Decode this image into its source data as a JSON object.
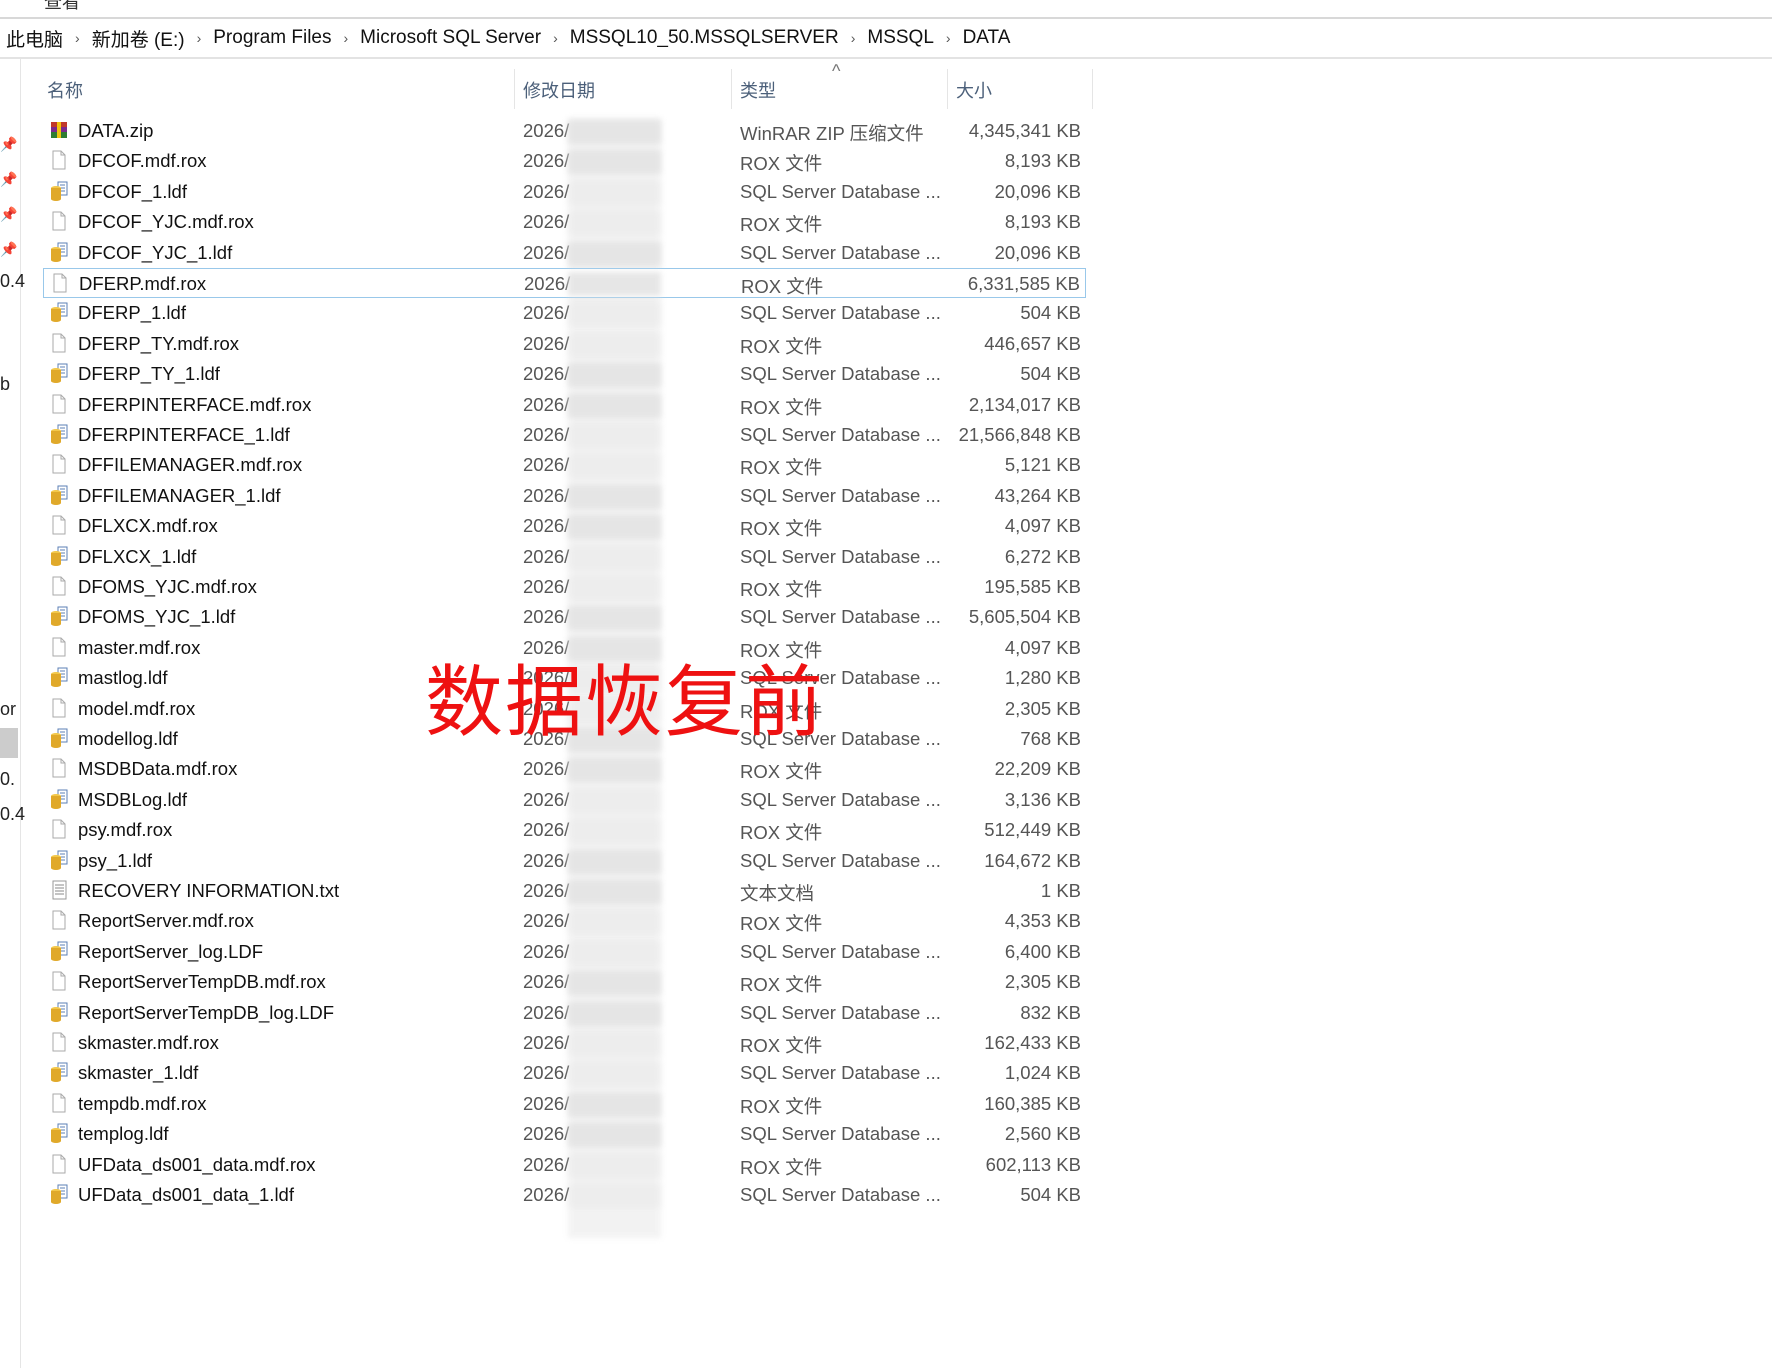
{
  "menu": {
    "view": "查看"
  },
  "breadcrumb": [
    "此电脑",
    "新加卷 (E:)",
    "Program Files",
    "Microsoft SQL Server",
    "MSSQL10_50.MSSQLSERVER",
    "MSSQL",
    "DATA"
  ],
  "columns": {
    "name": "名称",
    "date": "修改日期",
    "type": "类型",
    "size": "大小",
    "sort_indicator": "^"
  },
  "left_pane_fragments": [
    "0.4",
    "b",
    "or",
    "0.",
    "0.4"
  ],
  "files": [
    {
      "name": "DATA.zip",
      "date": "2026/",
      "type": "WinRAR ZIP 压缩文件",
      "size": "4,345,341 KB",
      "icon": "zip"
    },
    {
      "name": "DFCOF.mdf.rox",
      "date": "2026/",
      "type": "ROX 文件",
      "size": "8,193 KB",
      "icon": "file"
    },
    {
      "name": "DFCOF_1.ldf",
      "date": "2026/",
      "type": "SQL Server Database ...",
      "size": "20,096 KB",
      "icon": "db"
    },
    {
      "name": "DFCOF_YJC.mdf.rox",
      "date": "2026/",
      "type": "ROX 文件",
      "size": "8,193 KB",
      "icon": "file"
    },
    {
      "name": "DFCOF_YJC_1.ldf",
      "date": "2026/",
      "type": "SQL Server Database ...",
      "size": "20,096 KB",
      "icon": "db"
    },
    {
      "name": "DFERP.mdf.rox",
      "date": "2026/",
      "type": "ROX 文件",
      "size": "6,331,585 KB",
      "icon": "file",
      "selected": true
    },
    {
      "name": "DFERP_1.ldf",
      "date": "2026/",
      "type": "SQL Server Database ...",
      "size": "504 KB",
      "icon": "db"
    },
    {
      "name": "DFERP_TY.mdf.rox",
      "date": "2026/",
      "type": "ROX 文件",
      "size": "446,657 KB",
      "icon": "file"
    },
    {
      "name": "DFERP_TY_1.ldf",
      "date": "2026/",
      "type": "SQL Server Database ...",
      "size": "504 KB",
      "icon": "db"
    },
    {
      "name": "DFERPINTERFACE.mdf.rox",
      "date": "2026/",
      "type": "ROX 文件",
      "size": "2,134,017 KB",
      "icon": "file"
    },
    {
      "name": "DFERPINTERFACE_1.ldf",
      "date": "2026/",
      "type": "SQL Server Database ...",
      "size": "21,566,848 KB",
      "icon": "db"
    },
    {
      "name": "DFFILEMANAGER.mdf.rox",
      "date": "2026/",
      "type": "ROX 文件",
      "size": "5,121 KB",
      "icon": "file"
    },
    {
      "name": "DFFILEMANAGER_1.ldf",
      "date": "2026/",
      "type": "SQL Server Database ...",
      "size": "43,264 KB",
      "icon": "db"
    },
    {
      "name": "DFLXCX.mdf.rox",
      "date": "2026/",
      "type": "ROX 文件",
      "size": "4,097 KB",
      "icon": "file"
    },
    {
      "name": "DFLXCX_1.ldf",
      "date": "2026/",
      "type": "SQL Server Database ...",
      "size": "6,272 KB",
      "icon": "db"
    },
    {
      "name": "DFOMS_YJC.mdf.rox",
      "date": "2026/",
      "type": "ROX 文件",
      "size": "195,585 KB",
      "icon": "file"
    },
    {
      "name": "DFOMS_YJC_1.ldf",
      "date": "2026/",
      "type": "SQL Server Database ...",
      "size": "5,605,504 KB",
      "icon": "db"
    },
    {
      "name": "master.mdf.rox",
      "date": "2026/",
      "type": "ROX 文件",
      "size": "4,097 KB",
      "icon": "file"
    },
    {
      "name": "mastlog.ldf",
      "date": "2026/",
      "type": "SQL Server Database ...",
      "size": "1,280 KB",
      "icon": "db"
    },
    {
      "name": "model.mdf.rox",
      "date": "2026/",
      "type": "ROX 文件",
      "size": "2,305 KB",
      "icon": "file"
    },
    {
      "name": "modellog.ldf",
      "date": "2026/",
      "type": "SQL Server Database ...",
      "size": "768 KB",
      "icon": "db"
    },
    {
      "name": "MSDBData.mdf.rox",
      "date": "2026/",
      "type": "ROX 文件",
      "size": "22,209 KB",
      "icon": "file"
    },
    {
      "name": "MSDBLog.ldf",
      "date": "2026/",
      "type": "SQL Server Database ...",
      "size": "3,136 KB",
      "icon": "db"
    },
    {
      "name": "psy.mdf.rox",
      "date": "2026/",
      "type": "ROX 文件",
      "size": "512,449 KB",
      "icon": "file"
    },
    {
      "name": "psy_1.ldf",
      "date": "2026/",
      "type": "SQL Server Database ...",
      "size": "164,672 KB",
      "icon": "db"
    },
    {
      "name": "RECOVERY INFORMATION.txt",
      "date": "2026/",
      "type": "文本文档",
      "size": "1 KB",
      "icon": "txt"
    },
    {
      "name": "ReportServer.mdf.rox",
      "date": "2026/",
      "type": "ROX 文件",
      "size": "4,353 KB",
      "icon": "file"
    },
    {
      "name": "ReportServer_log.LDF",
      "date": "2026/",
      "type": "SQL Server Database ...",
      "size": "6,400 KB",
      "icon": "db"
    },
    {
      "name": "ReportServerTempDB.mdf.rox",
      "date": "2026/",
      "type": "ROX 文件",
      "size": "2,305 KB",
      "icon": "file"
    },
    {
      "name": "ReportServerTempDB_log.LDF",
      "date": "2026/",
      "type": "SQL Server Database ...",
      "size": "832 KB",
      "icon": "db"
    },
    {
      "name": "skmaster.mdf.rox",
      "date": "2026/",
      "type": "ROX 文件",
      "size": "162,433 KB",
      "icon": "file"
    },
    {
      "name": "skmaster_1.ldf",
      "date": "2026/",
      "type": "SQL Server Database ...",
      "size": "1,024 KB",
      "icon": "db"
    },
    {
      "name": "tempdb.mdf.rox",
      "date": "2026/",
      "type": "ROX 文件",
      "size": "160,385 KB",
      "icon": "file"
    },
    {
      "name": "templog.ldf",
      "date": "2026/",
      "type": "SQL Server Database ...",
      "size": "2,560 KB",
      "icon": "db"
    },
    {
      "name": "UFData_ds001_data.mdf.rox",
      "date": "2026/",
      "type": "ROX 文件",
      "size": "602,113 KB",
      "icon": "file"
    },
    {
      "name": "UFData_ds001_data_1.ldf",
      "date": "2026/",
      "type": "SQL Server Database ...",
      "size": "504 KB",
      "icon": "db"
    }
  ],
  "watermark": "数据恢复前",
  "colors": {
    "watermark": "#ee1111",
    "selection_border": "#99c8ea",
    "header_text": "#4c607a"
  }
}
